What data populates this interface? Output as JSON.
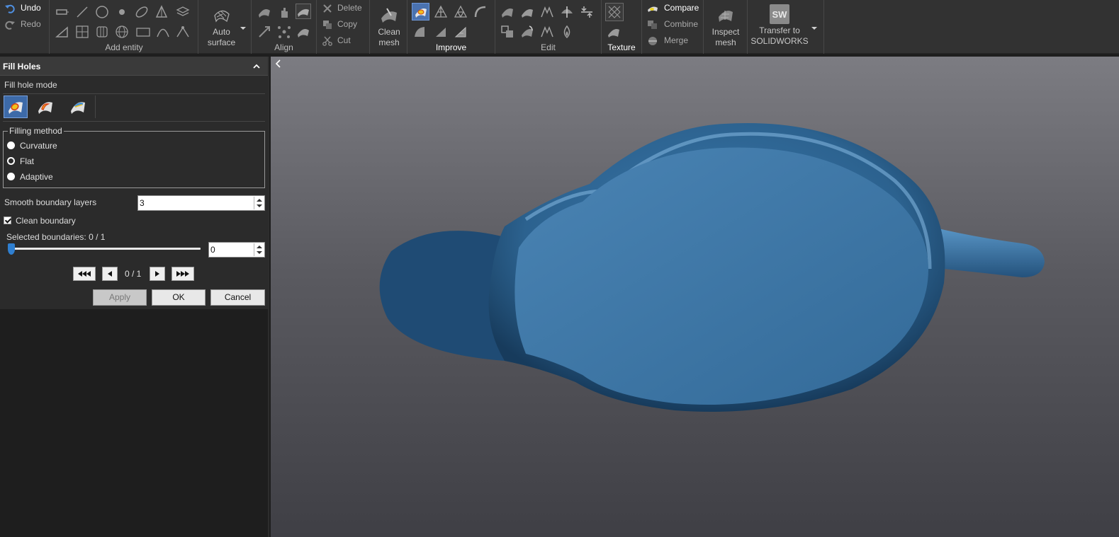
{
  "ribbon": {
    "undo": "Undo",
    "redo": "Redo",
    "add_entity": "Add entity",
    "auto_surface": [
      "Auto",
      "surface"
    ],
    "align": "Align",
    "delete": "Delete",
    "copy": "Copy",
    "cut": "Cut",
    "clean_mesh": [
      "Clean",
      "mesh"
    ],
    "improve": "Improve",
    "edit": "Edit",
    "texture": "Texture",
    "compare": "Compare",
    "combine": "Combine",
    "merge": "Merge",
    "inspect_mesh": [
      "Inspect",
      "mesh"
    ],
    "transfer": [
      "Transfer to",
      "SOLIDWORKS"
    ],
    "sw_logo": "SW"
  },
  "panel": {
    "title": "Fill Holes",
    "fill_hole_mode": "Fill hole mode",
    "filling_method": "Filling method",
    "methods": [
      "Curvature",
      "Flat",
      "Adaptive"
    ],
    "selected_method": "Flat",
    "smooth_boundary_label": "Smooth boundary layers",
    "smooth_boundary_value": "3",
    "clean_boundary_label": "Clean boundary",
    "clean_boundary_checked": true,
    "selected_boundaries": "Selected boundaries: 0 / 1",
    "slider_value": "0",
    "slider_fraction": 0,
    "page_indicator": "0 / 1",
    "apply": "Apply",
    "ok": "OK",
    "cancel": "Cancel"
  },
  "colors": {
    "accent": "#4a72b0",
    "model": "#2f6a9e",
    "viewport_top": "#7c7c82",
    "viewport_bottom": "#3f3f45"
  }
}
